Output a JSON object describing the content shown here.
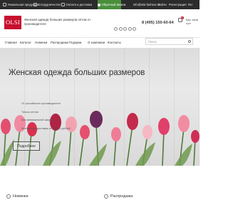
{
  "topbar": {
    "items": [
      {
        "label": "Уникальная продукция",
        "icon": "star-icon"
      },
      {
        "label": "Сотрудничество",
        "icon": "handshake-icon"
      },
      {
        "label": "Оплата и доставка",
        "icon": "truck-icon"
      }
    ],
    "cart_button": "Обратный звонок",
    "email": "info@olsi-fashion.ru",
    "links": [
      "Войти",
      "Регистрация"
    ],
    "currency": "RU"
  },
  "header": {
    "logo": "OLSI",
    "tagline": "Женская одежда больших размеров оптом от производителя",
    "social_icons": [
      "vk-icon",
      "telegram-icon",
      "viber-icon",
      "whatsapp-icon",
      "instagram-icon"
    ],
    "phone": "8 (495) 150-60-64",
    "cart_count": "0",
    "cart_label": "Ваш заказ пуст"
  },
  "nav": {
    "items": [
      "Главная",
      "Каталог",
      "Новинки",
      "Распродажа",
      "Подарки",
      "О компании",
      "Контакты"
    ],
    "search_placeholder": "Поиск"
  },
  "hero": {
    "title": "Женская одежда больших размеров",
    "bullets": [
      "От российского производителя",
      "Только оптом",
      "Без минимальной закупки",
      "Бесплатная доставка от 30 000 рублей"
    ],
    "button": "Подробнее"
  },
  "bottom": {
    "left_title": "Новинки",
    "right_title": "Распродажа"
  },
  "colors": {
    "brand": "#c8102e",
    "topbar": "#2b2b2b",
    "accent_green": "#4a8f3c"
  }
}
